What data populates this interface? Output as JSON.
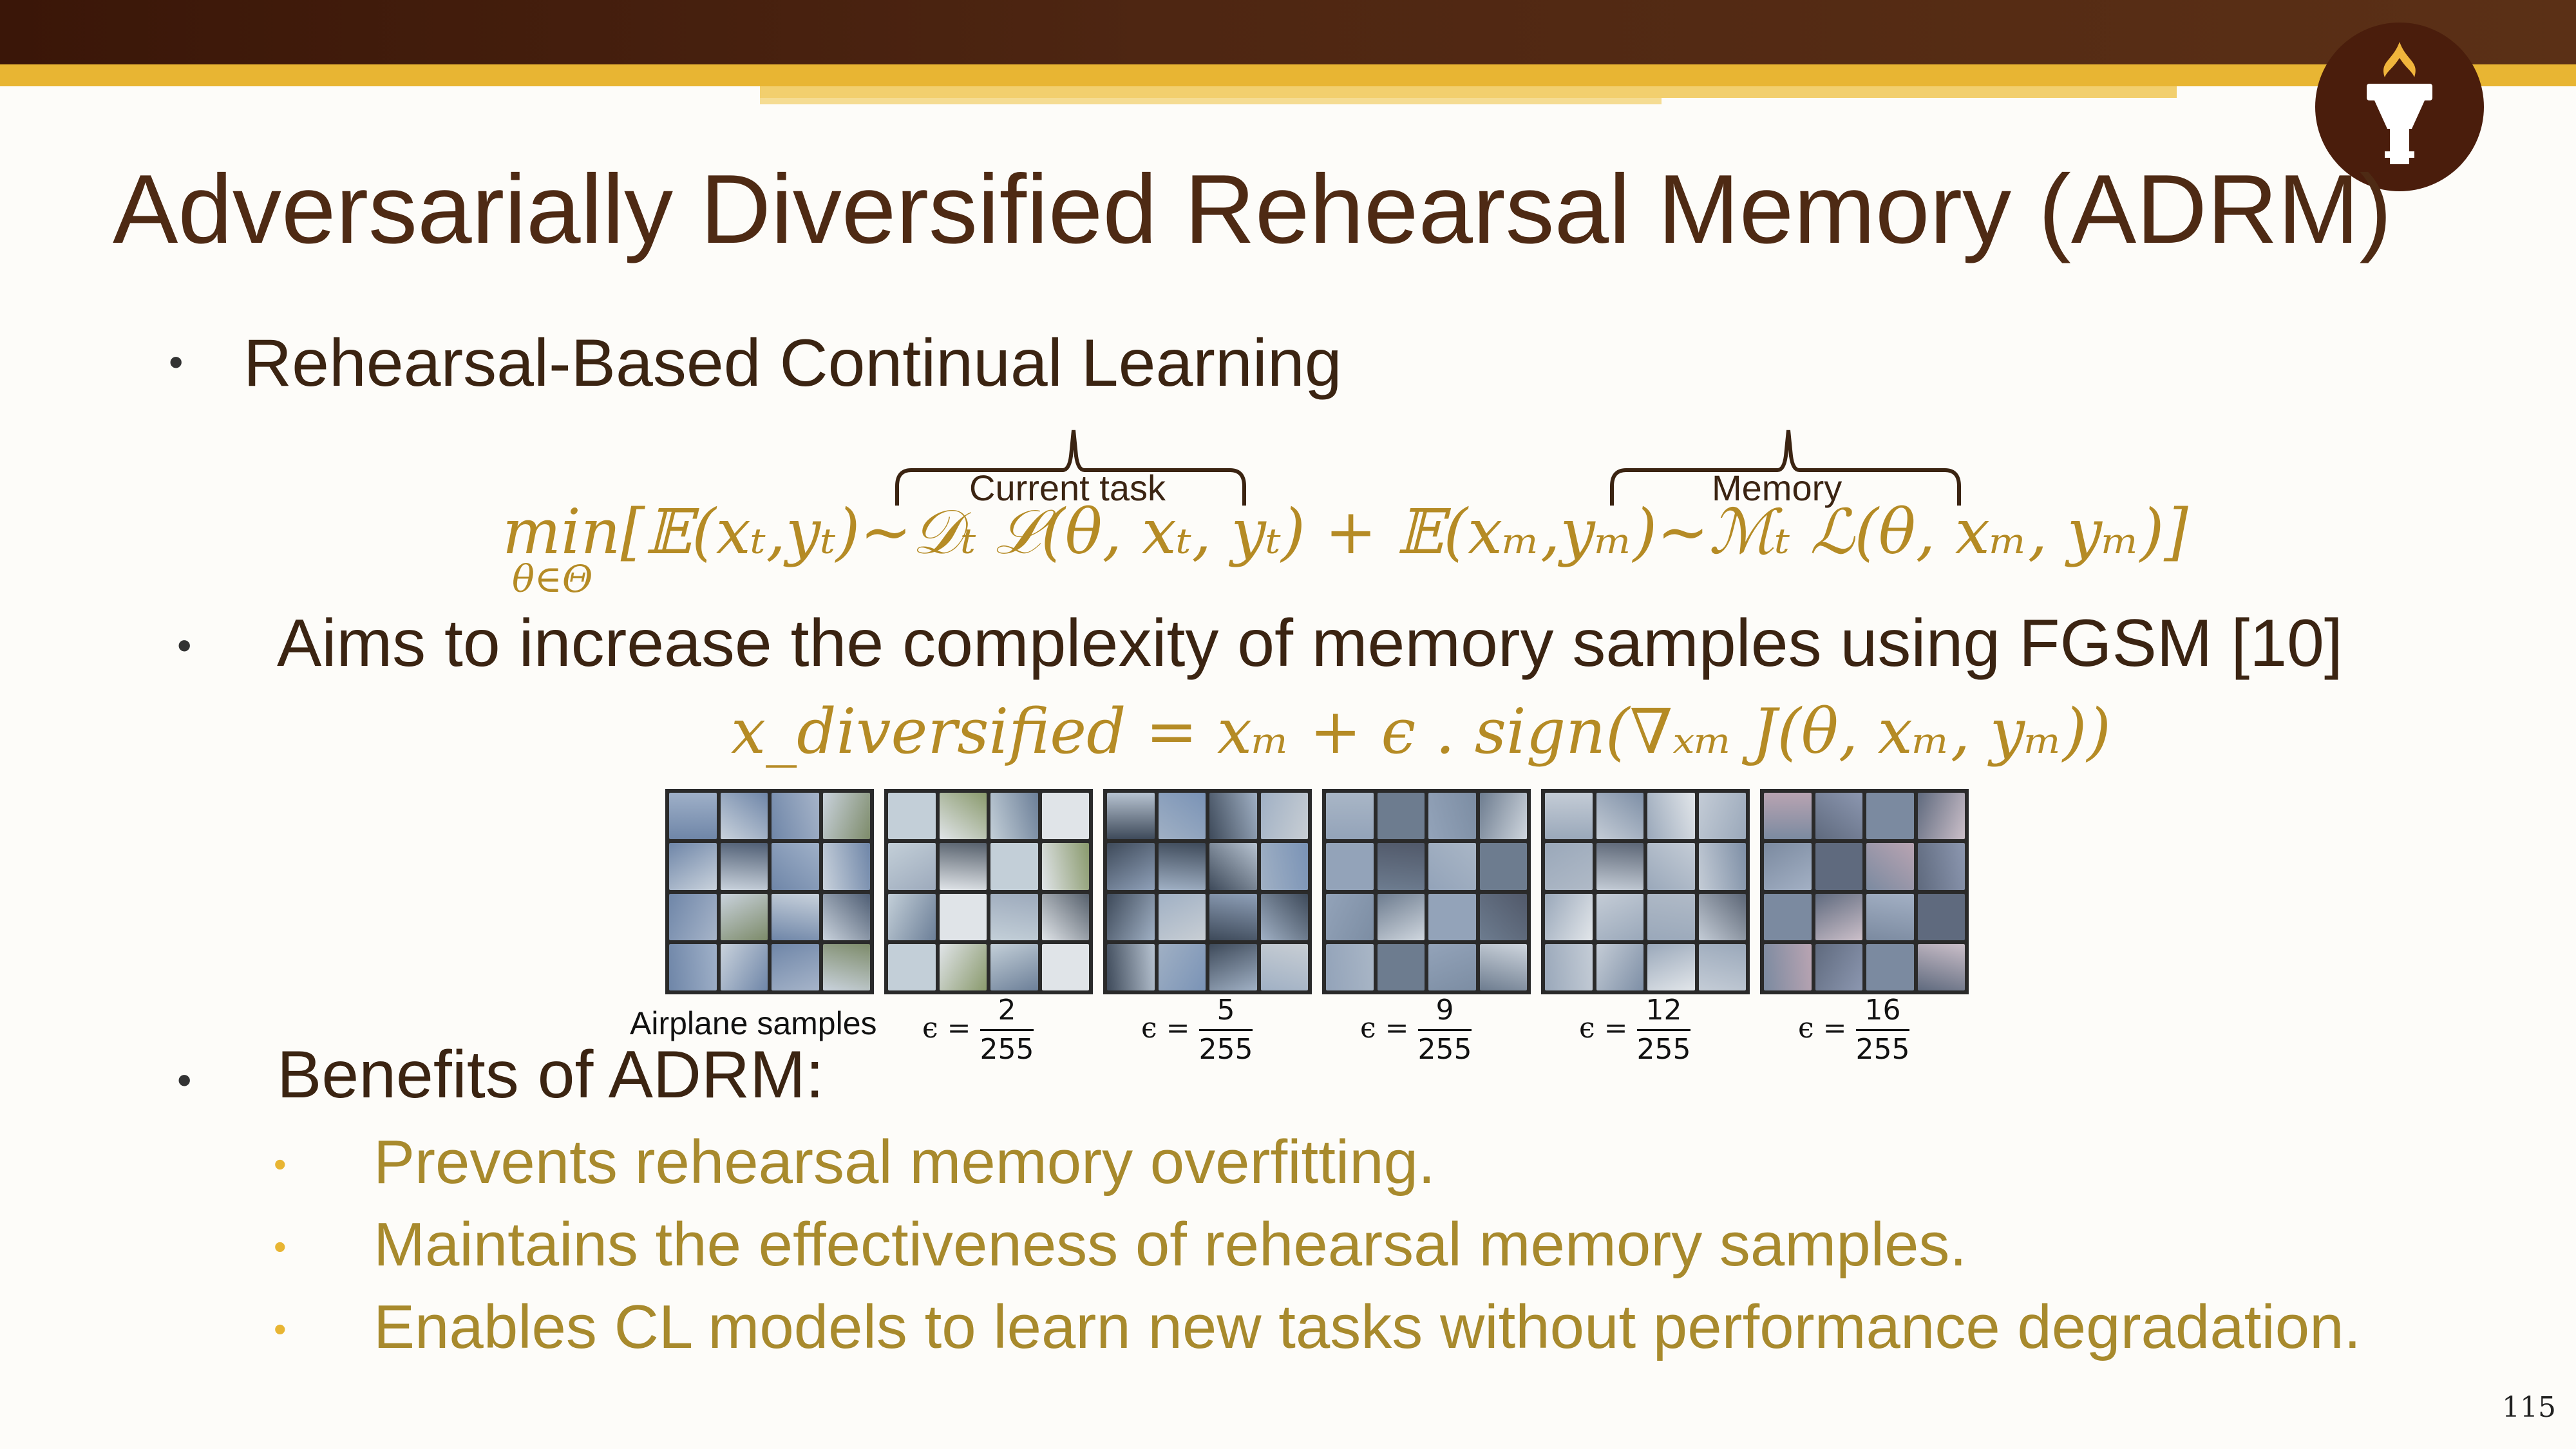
{
  "slide": {
    "title": "Adversarially Diversified Rehearsal Memory (ADRM)",
    "page_number": "115",
    "bullets": {
      "b1": "Rehearsal-Based Continual Learning",
      "b2": "Aims to increase the complexity of memory samples using FGSM [10]",
      "b3": "Benefits of ADRM:"
    },
    "sub_bullets": [
      "Prevents rehearsal memory overfitting.",
      "Maintains the effectiveness of rehearsal memory samples.",
      "Enables CL models to learn new tasks without performance degradation."
    ],
    "brace_labels": {
      "current": "Current task",
      "memory": "Memory"
    },
    "equation1": "min[𝔼(xₜ,yₜ)~𝒟ₜ ℒ(θ, xₜ, yₜ) + 𝔼(xₘ,yₘ)~ℳₜ ℒ(θ, xₘ, yₘ)]",
    "equation1_sub": "θ∈Θ",
    "equation2": "x_diversified = xₘ + ϵ . sign(∇ₓₘ J(θ,  xₘ,  yₘ))",
    "images": {
      "caption": "Airplane samples",
      "epsilons": [
        {
          "num": "2",
          "den": "255"
        },
        {
          "num": "5",
          "den": "255"
        },
        {
          "num": "9",
          "den": "255"
        },
        {
          "num": "12",
          "den": "255"
        },
        {
          "num": "16",
          "den": "255"
        }
      ],
      "eps_prefix": "ϵ ="
    },
    "colors": {
      "title": "#4e2a14",
      "accent_gold": "#b58b25",
      "header_dark": "#3a1608",
      "header_gold": "#e8b533"
    }
  }
}
